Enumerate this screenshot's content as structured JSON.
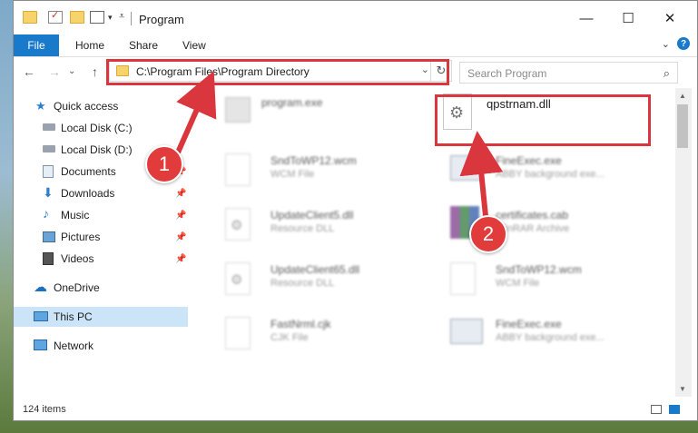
{
  "window": {
    "title": "Program"
  },
  "ribbon": {
    "file": "File",
    "tabs": [
      "Home",
      "Share",
      "View"
    ],
    "help": "?"
  },
  "navbar": {
    "back": "←",
    "forward": "→",
    "recent": "⌄",
    "up": "↑",
    "address": "C:\\Program Files\\Program Directory",
    "search_placeholder": "Search Program"
  },
  "sidebar": {
    "items": [
      {
        "label": "Quick access",
        "icon": "star-icon"
      },
      {
        "label": "Local Disk (C:)",
        "icon": "drive-icon"
      },
      {
        "label": "Local Disk (D:)",
        "icon": "drive-icon"
      },
      {
        "label": "Documents",
        "icon": "documents-icon"
      },
      {
        "label": "Downloads",
        "icon": "download-icon"
      },
      {
        "label": "Music",
        "icon": "music-icon"
      },
      {
        "label": "Pictures",
        "icon": "pictures-icon"
      },
      {
        "label": "Videos",
        "icon": "videos-icon"
      },
      {
        "label": "OneDrive",
        "icon": "cloud-icon"
      },
      {
        "label": "This PC",
        "icon": "computer-icon"
      },
      {
        "label": "Network",
        "icon": "network-icon"
      }
    ]
  },
  "files": [
    {
      "name": "program.exe",
      "type": ""
    },
    {
      "name": "qpstrnam.dll",
      "type": ""
    },
    {
      "name": "SndToWP12.wcm",
      "type": "WCM File"
    },
    {
      "name": "FineExec.exe",
      "type": "ABBY background exe..."
    },
    {
      "name": "UpdateClient5.dll",
      "type": "Resource DLL"
    },
    {
      "name": "certificates.cab",
      "type": "WinRAR Archive"
    },
    {
      "name": "UpdateClient65.dll",
      "type": "Resource DLL"
    },
    {
      "name": "SndToWP12.wcm",
      "type": "WCM File"
    },
    {
      "name": "FastNrml.cjk",
      "type": "CJK File"
    },
    {
      "name": "FineExec.exe",
      "type": "ABBY background exe..."
    }
  ],
  "status": {
    "items": "124 items"
  },
  "annotations": {
    "step1": "1",
    "step2": "2",
    "color": "#d9363e"
  }
}
